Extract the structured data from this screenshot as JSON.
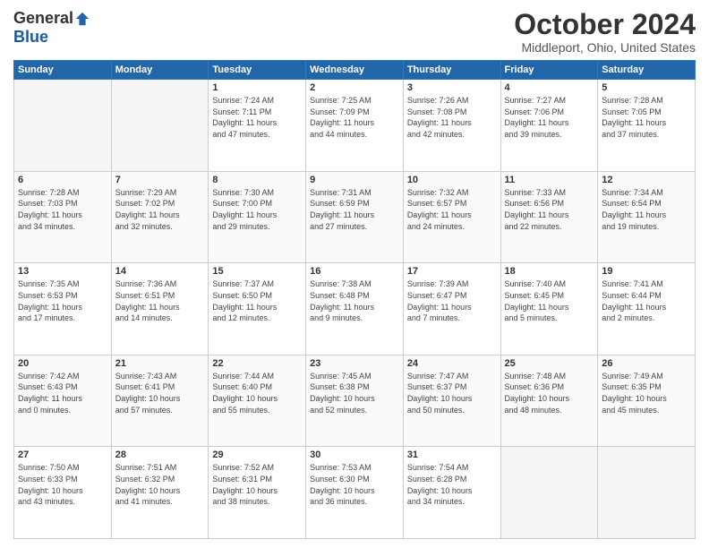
{
  "logo": {
    "general": "General",
    "blue": "Blue"
  },
  "header": {
    "month": "October 2024",
    "location": "Middleport, Ohio, United States"
  },
  "weekdays": [
    "Sunday",
    "Monday",
    "Tuesday",
    "Wednesday",
    "Thursday",
    "Friday",
    "Saturday"
  ],
  "weeks": [
    [
      {
        "day": "",
        "info": ""
      },
      {
        "day": "",
        "info": ""
      },
      {
        "day": "1",
        "info": "Sunrise: 7:24 AM\nSunset: 7:11 PM\nDaylight: 11 hours\nand 47 minutes."
      },
      {
        "day": "2",
        "info": "Sunrise: 7:25 AM\nSunset: 7:09 PM\nDaylight: 11 hours\nand 44 minutes."
      },
      {
        "day": "3",
        "info": "Sunrise: 7:26 AM\nSunset: 7:08 PM\nDaylight: 11 hours\nand 42 minutes."
      },
      {
        "day": "4",
        "info": "Sunrise: 7:27 AM\nSunset: 7:06 PM\nDaylight: 11 hours\nand 39 minutes."
      },
      {
        "day": "5",
        "info": "Sunrise: 7:28 AM\nSunset: 7:05 PM\nDaylight: 11 hours\nand 37 minutes."
      }
    ],
    [
      {
        "day": "6",
        "info": "Sunrise: 7:28 AM\nSunset: 7:03 PM\nDaylight: 11 hours\nand 34 minutes."
      },
      {
        "day": "7",
        "info": "Sunrise: 7:29 AM\nSunset: 7:02 PM\nDaylight: 11 hours\nand 32 minutes."
      },
      {
        "day": "8",
        "info": "Sunrise: 7:30 AM\nSunset: 7:00 PM\nDaylight: 11 hours\nand 29 minutes."
      },
      {
        "day": "9",
        "info": "Sunrise: 7:31 AM\nSunset: 6:59 PM\nDaylight: 11 hours\nand 27 minutes."
      },
      {
        "day": "10",
        "info": "Sunrise: 7:32 AM\nSunset: 6:57 PM\nDaylight: 11 hours\nand 24 minutes."
      },
      {
        "day": "11",
        "info": "Sunrise: 7:33 AM\nSunset: 6:56 PM\nDaylight: 11 hours\nand 22 minutes."
      },
      {
        "day": "12",
        "info": "Sunrise: 7:34 AM\nSunset: 6:54 PM\nDaylight: 11 hours\nand 19 minutes."
      }
    ],
    [
      {
        "day": "13",
        "info": "Sunrise: 7:35 AM\nSunset: 6:53 PM\nDaylight: 11 hours\nand 17 minutes."
      },
      {
        "day": "14",
        "info": "Sunrise: 7:36 AM\nSunset: 6:51 PM\nDaylight: 11 hours\nand 14 minutes."
      },
      {
        "day": "15",
        "info": "Sunrise: 7:37 AM\nSunset: 6:50 PM\nDaylight: 11 hours\nand 12 minutes."
      },
      {
        "day": "16",
        "info": "Sunrise: 7:38 AM\nSunset: 6:48 PM\nDaylight: 11 hours\nand 9 minutes."
      },
      {
        "day": "17",
        "info": "Sunrise: 7:39 AM\nSunset: 6:47 PM\nDaylight: 11 hours\nand 7 minutes."
      },
      {
        "day": "18",
        "info": "Sunrise: 7:40 AM\nSunset: 6:45 PM\nDaylight: 11 hours\nand 5 minutes."
      },
      {
        "day": "19",
        "info": "Sunrise: 7:41 AM\nSunset: 6:44 PM\nDaylight: 11 hours\nand 2 minutes."
      }
    ],
    [
      {
        "day": "20",
        "info": "Sunrise: 7:42 AM\nSunset: 6:43 PM\nDaylight: 11 hours\nand 0 minutes."
      },
      {
        "day": "21",
        "info": "Sunrise: 7:43 AM\nSunset: 6:41 PM\nDaylight: 10 hours\nand 57 minutes."
      },
      {
        "day": "22",
        "info": "Sunrise: 7:44 AM\nSunset: 6:40 PM\nDaylight: 10 hours\nand 55 minutes."
      },
      {
        "day": "23",
        "info": "Sunrise: 7:45 AM\nSunset: 6:38 PM\nDaylight: 10 hours\nand 52 minutes."
      },
      {
        "day": "24",
        "info": "Sunrise: 7:47 AM\nSunset: 6:37 PM\nDaylight: 10 hours\nand 50 minutes."
      },
      {
        "day": "25",
        "info": "Sunrise: 7:48 AM\nSunset: 6:36 PM\nDaylight: 10 hours\nand 48 minutes."
      },
      {
        "day": "26",
        "info": "Sunrise: 7:49 AM\nSunset: 6:35 PM\nDaylight: 10 hours\nand 45 minutes."
      }
    ],
    [
      {
        "day": "27",
        "info": "Sunrise: 7:50 AM\nSunset: 6:33 PM\nDaylight: 10 hours\nand 43 minutes."
      },
      {
        "day": "28",
        "info": "Sunrise: 7:51 AM\nSunset: 6:32 PM\nDaylight: 10 hours\nand 41 minutes."
      },
      {
        "day": "29",
        "info": "Sunrise: 7:52 AM\nSunset: 6:31 PM\nDaylight: 10 hours\nand 38 minutes."
      },
      {
        "day": "30",
        "info": "Sunrise: 7:53 AM\nSunset: 6:30 PM\nDaylight: 10 hours\nand 36 minutes."
      },
      {
        "day": "31",
        "info": "Sunrise: 7:54 AM\nSunset: 6:28 PM\nDaylight: 10 hours\nand 34 minutes."
      },
      {
        "day": "",
        "info": ""
      },
      {
        "day": "",
        "info": ""
      }
    ]
  ]
}
